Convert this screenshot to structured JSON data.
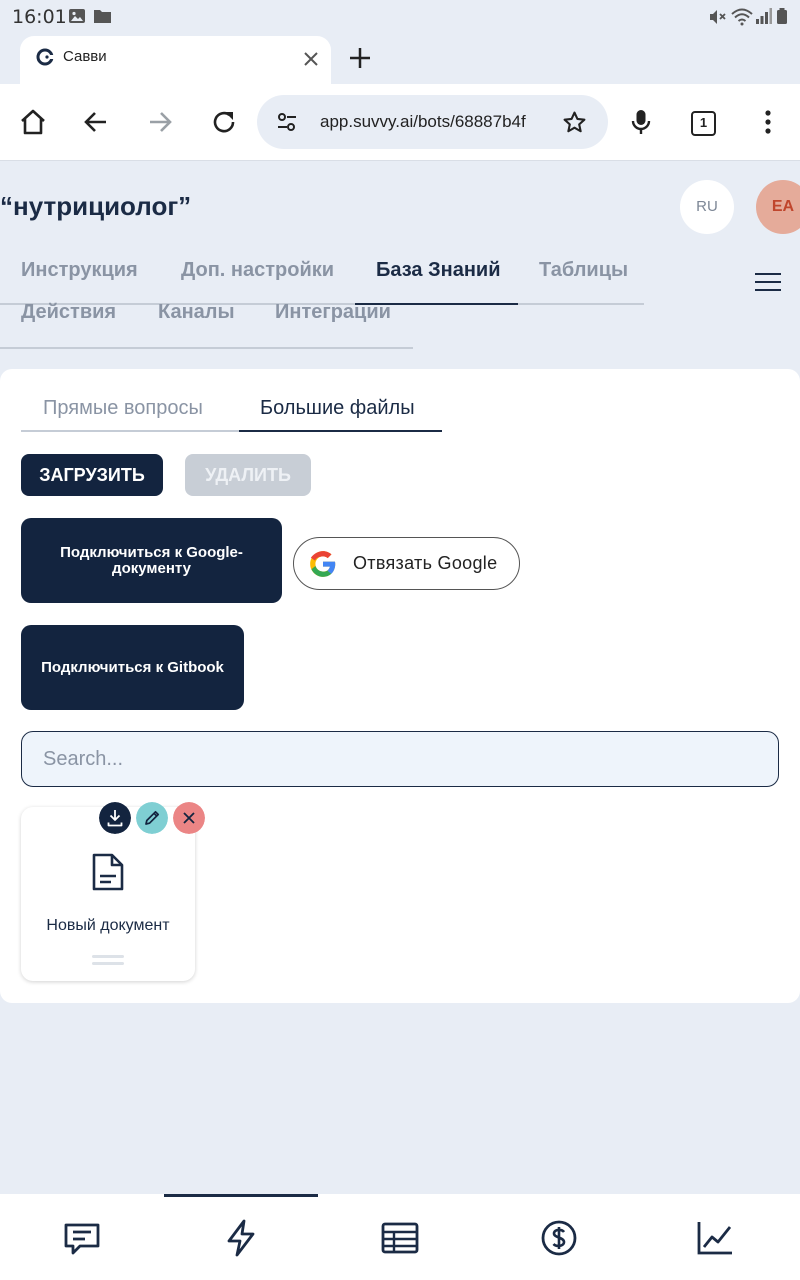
{
  "status_bar": {
    "time": "16:01",
    "icons": [
      "image-icon",
      "folder-icon",
      "mute-icon",
      "wifi-icon",
      "signal-icon"
    ]
  },
  "browser": {
    "tab": {
      "title": "Савви",
      "favicon": "suvvy-favicon-icon"
    },
    "url": "app.suvvy.ai/bots/68887b4f",
    "tab_count": "1"
  },
  "header": {
    "bot_title": "“нутрициолог”",
    "language": "RU",
    "avatar_initials": "EA"
  },
  "nav_tabs": [
    {
      "label": "Инструкция",
      "active": false
    },
    {
      "label": "Доп. настройки",
      "active": false
    },
    {
      "label": "База Знаний",
      "active": true
    },
    {
      "label": "Таблицы",
      "active": false
    },
    {
      "label": "Действия",
      "active": false
    },
    {
      "label": "Каналы",
      "active": false
    },
    {
      "label": "Интеграции",
      "active": false
    }
  ],
  "knowledge": {
    "subtabs": [
      {
        "label": "Прямые вопросы",
        "active": false
      },
      {
        "label": "Большие файлы",
        "active": true
      }
    ],
    "upload_button": "ЗАГРУЗИТЬ",
    "delete_button": "УДАЛИТЬ",
    "connect_google_button": "Подключиться к Google-документу",
    "unlink_google_button": "Отвязать Google",
    "connect_gitbook_button": "Подключиться к Gitbook",
    "search_placeholder": "Search...",
    "documents": [
      {
        "name": "Новый документ"
      }
    ]
  },
  "colors": {
    "primary": "#13243f",
    "page_bg": "#e8edf5",
    "edit_button": "#7fcfd3",
    "delete_button": "#eb8585",
    "avatar_bg": "#e5ab9a",
    "avatar_text": "#c0462d"
  },
  "bottom_nav": [
    "chat-icon",
    "lightning-icon",
    "table-icon",
    "dollar-icon",
    "chart-icon"
  ]
}
